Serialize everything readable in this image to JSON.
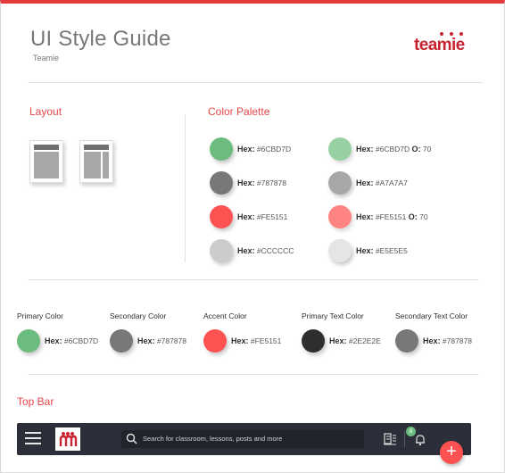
{
  "header": {
    "title": "UI Style Guide",
    "subtitle": "Teamie",
    "logo_text": "teamie",
    "brand_color": "#C8242F",
    "accent_rule_color": "#E33B3B"
  },
  "sections": {
    "layout_title": "Layout",
    "palette_title": "Color Palette",
    "topbar_title": "Top Bar"
  },
  "palette": [
    {
      "hex_prefix": "Hex:",
      "hex": "#6CBD7D",
      "color": "#6CBD7D"
    },
    {
      "hex_prefix": "Hex:",
      "hex": "#6CBD7D",
      "opacity_prefix": "O:",
      "opacity": "70",
      "color": "#6CBD7D",
      "alpha": 0.7
    },
    {
      "hex_prefix": "Hex:",
      "hex": "#787878",
      "color": "#787878"
    },
    {
      "hex_prefix": "Hex:",
      "hex": "#A7A7A7",
      "color": "#A7A7A7"
    },
    {
      "hex_prefix": "Hex:",
      "hex": "#FE5151",
      "color": "#FE5151"
    },
    {
      "hex_prefix": "Hex:",
      "hex": "#FE5151",
      "opacity_prefix": "O:",
      "opacity": "70",
      "color": "#FE5151",
      "alpha": 0.7
    },
    {
      "hex_prefix": "Hex:",
      "hex": "#CCCCCC",
      "color": "#CCCCCC"
    },
    {
      "hex_prefix": "Hex:",
      "hex": "#E5E5E5",
      "color": "#E5E5E5"
    }
  ],
  "roles": [
    {
      "label": "Primary Color",
      "hex_prefix": "Hex:",
      "hex": "#6CBD7D",
      "color": "#6CBD7D"
    },
    {
      "label": "Secondary Color",
      "hex_prefix": "Hex:",
      "hex": "#787878",
      "color": "#787878"
    },
    {
      "label": "Accent Color",
      "hex_prefix": "Hex:",
      "hex": "#FE5151",
      "color": "#FE5151"
    },
    {
      "label": "Primary Text Color",
      "hex_prefix": "Hex:",
      "hex": "#2E2E2E",
      "color": "#2E2E2E"
    },
    {
      "label": "Secondary Text Color",
      "hex_prefix": "Hex:",
      "hex": "#787878",
      "color": "#787878"
    }
  ],
  "topbar": {
    "search_placeholder": "Search for classroom, lessons, posts and more",
    "notification_count": "8",
    "fab_label": "+",
    "bar_color": "#2c2f3a",
    "icons": [
      "hamburger-menu-icon",
      "teamie-brand-icon",
      "search-icon",
      "book-list-icon",
      "bell-icon",
      "plus-icon"
    ]
  }
}
